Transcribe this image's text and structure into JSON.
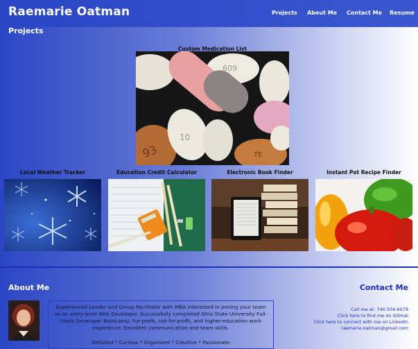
{
  "header": {
    "brand": "Raemarie Oatman",
    "nav": [
      "Projects",
      "About Me",
      "Contact Me",
      "Resume"
    ]
  },
  "projects": {
    "heading": "Projects",
    "featured": {
      "title": "Custom Medication List"
    },
    "items": [
      {
        "title": "Local Weather Tracker"
      },
      {
        "title": "Education Credit Calculator"
      },
      {
        "title": "Electronic Book Finder"
      },
      {
        "title": "Instant Pot Recipe Finder"
      }
    ]
  },
  "about": {
    "heading": "About Me",
    "bio": "Experienced Leader and Group Facilitator with MBA interested in joining your team as an entry-level Web Developer. Successfully completed Ohio State University Full-Stack Developer Bootcamp. For-profit, not-for-profit, and higher-education work experience. Excellent communication and team skills.",
    "traits": "Detailed * Curious * Organized * Creative * Passionate"
  },
  "contact": {
    "heading": "Contact Me",
    "phone": "Call me at: 740.504.6078",
    "github": "Click here to find me on GitHub",
    "linkedin": "Click here to connect with me on LinkedIn",
    "email": "raemarie.oatman@gmail.com"
  },
  "colors": {
    "accent": "#1a2ec0",
    "gradient_start": "#2a46c4",
    "gradient_end": "#ffffff"
  }
}
